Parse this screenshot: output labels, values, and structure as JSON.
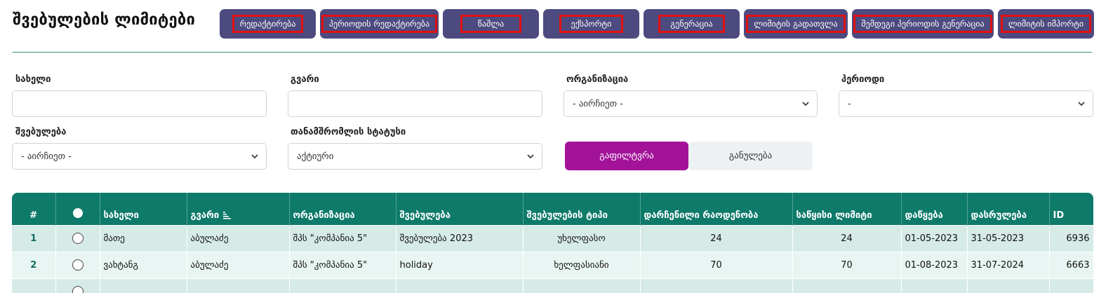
{
  "page": {
    "title": "შვებულების ლიმიტები"
  },
  "toolbar": [
    {
      "label": "რედაქტირება",
      "width": 137
    },
    {
      "label": "პერიოდის რედაქტირება",
      "width": 169
    },
    {
      "label": "წაშლა",
      "width": 137
    },
    {
      "label": "ექსპორტი",
      "width": 137
    },
    {
      "label": "გენერაცია",
      "width": 137
    },
    {
      "label": "ლიმიტის გადათვლა",
      "width": 148
    },
    {
      "label": "შემდეგი პერიოდის გენერაცია",
      "width": 202
    },
    {
      "label": "ლიმიტის იმპორტი",
      "width": 137
    }
  ],
  "filters": {
    "name_label": "სახელი",
    "surname_label": "გვარი",
    "organization_label": "ორგანიზაცია",
    "organization_value": "- აირჩიეთ -",
    "period_label": "პერიოდი",
    "period_value": "-",
    "leave_label": "შვებულება",
    "leave_value": "- აირჩიეთ -",
    "status_label": "თანამშრომლის სტატუსი",
    "status_value": "აქტიური",
    "filter_button": "გაფილტვრა",
    "reset_button": "განულება"
  },
  "table": {
    "headers": {
      "num": "#",
      "name": "სახელი",
      "surname": "გვარი",
      "organization": "ორგანიზაცია",
      "leave": "შვებულება",
      "leave_type": "შვებულების ტიპი",
      "remaining": "დარჩენილი რაოდენობა",
      "initial_limit": "საწყისი ლიმიტი",
      "start": "დაწყება",
      "end": "დასრულება",
      "id": "ID"
    },
    "rows": [
      {
        "num": "1",
        "name": "მათე",
        "surname": "აბულაძე",
        "organization": "შპს \"კომპანია 5\"",
        "leave": "შვებულება 2023",
        "leave_type": "უხელფასო",
        "remaining": "24",
        "initial_limit": "24",
        "start": "01-05-2023",
        "end": "31-05-2023",
        "id": "6936"
      },
      {
        "num": "2",
        "name": "ვახტანგ",
        "surname": "აბულაძე",
        "organization": "შპს \"კომპანია 5\"",
        "leave": "holiday",
        "leave_type": "ხელფასიანი",
        "remaining": "70",
        "initial_limit": "70",
        "start": "01-08-2023",
        "end": "31-07-2024",
        "id": "6663"
      }
    ]
  },
  "colors": {
    "toolbar_bg": "#4d4a7f",
    "highlight": "#e30f0f",
    "table_header": "#0e7a6a",
    "filter_btn": "#a3139a"
  }
}
